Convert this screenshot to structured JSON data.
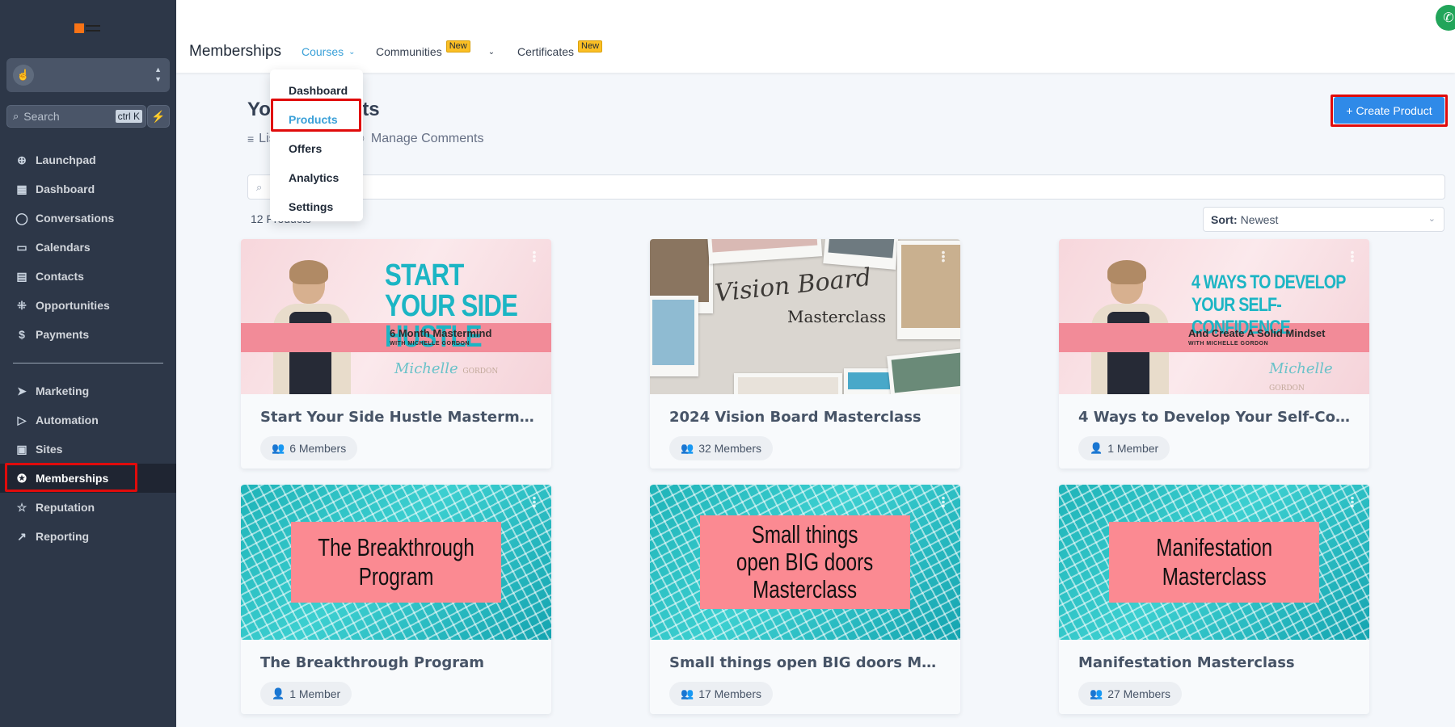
{
  "app": {
    "title": "Memberships",
    "logo": "agency-logo",
    "location_switcher_icon": "pointer-click-icon"
  },
  "sidebar": {
    "search_placeholder": "Search",
    "search_shortcut": "ctrl K",
    "quick_action_icon": "bolt-icon",
    "items": [
      {
        "label": "Launchpad",
        "icon": "launchpad-icon",
        "active": false
      },
      {
        "label": "Dashboard",
        "icon": "dashboard-grid-icon",
        "active": false
      },
      {
        "label": "Conversations",
        "icon": "chat-bubble-icon",
        "active": false
      },
      {
        "label": "Calendars",
        "icon": "calendar-icon",
        "active": false
      },
      {
        "label": "Contacts",
        "icon": "contacts-book-icon",
        "active": false
      },
      {
        "label": "Opportunities",
        "icon": "opportunities-icon",
        "active": false
      },
      {
        "label": "Payments",
        "icon": "payments-icon",
        "active": false
      },
      {
        "label": "Marketing",
        "icon": "send-icon",
        "active": false
      },
      {
        "label": "Automation",
        "icon": "automation-icon",
        "active": false
      },
      {
        "label": "Sites",
        "icon": "sites-icon",
        "active": false
      },
      {
        "label": "Memberships",
        "icon": "award-icon",
        "active": true
      },
      {
        "label": "Reputation",
        "icon": "star-icon",
        "active": false
      },
      {
        "label": "Reporting",
        "icon": "trend-icon",
        "active": false
      }
    ]
  },
  "topnav": {
    "items": [
      {
        "label": "Courses",
        "active": true,
        "has_dropdown": true,
        "badge": ""
      },
      {
        "label": "Communities",
        "active": false,
        "has_dropdown": true,
        "badge": "New"
      },
      {
        "label": "Certificates",
        "active": false,
        "has_dropdown": false,
        "badge": "New"
      }
    ],
    "courses_menu": [
      "Dashboard",
      "Products",
      "Offers",
      "Analytics",
      "Settings"
    ],
    "courses_menu_active": "Products"
  },
  "main": {
    "title": "Your Products",
    "subtabs": [
      {
        "label": "List",
        "icon": "list-icon"
      },
      {
        "label": "Manage Comments",
        "icon": "comments-icon"
      }
    ],
    "create_button": "+ Create Product",
    "search_placeholder": "",
    "count_label": "12 Products",
    "sort_label": "Sort:",
    "sort_value": "Newest"
  },
  "products": [
    {
      "title": "Start Your Side Hustle Mastermind",
      "members": "6 Members",
      "member_icon": "users-icon",
      "thumb": {
        "style": "pink",
        "headline": "START YOUR SIDE HUSTLE",
        "line1": "6 Month Mastermind",
        "line2": "WITH MICHELLE GORDON",
        "signature": "Michelle",
        "signature2": "GORDON"
      }
    },
    {
      "title": "2024 Vision Board Masterclass",
      "members": "32 Members",
      "member_icon": "users-icon",
      "thumb": {
        "style": "vision",
        "headline": "Vision Board",
        "line1": "Masterclass"
      }
    },
    {
      "title": "4 Ways to Develop Your Self-Conf...",
      "members": "1 Member",
      "member_icon": "user-icon",
      "thumb": {
        "style": "pink",
        "headline": "4 WAYS TO DEVELOP YOUR SELF-CONFIDENCE",
        "line1": "And Create A Solid Mindset",
        "line2": "WITH MICHELLE GORDON",
        "signature": "Michelle",
        "signature2": "GORDON"
      }
    },
    {
      "title": "The Breakthrough Program",
      "members": "1 Member",
      "member_icon": "user-icon",
      "thumb": {
        "style": "pool",
        "headline": "The Breakthrough\nProgram"
      }
    },
    {
      "title": "Small things open BIG doors Mas...",
      "members": "17 Members",
      "member_icon": "users-icon",
      "thumb": {
        "style": "pool",
        "headline": "Small things\nopen BIG doors\nMasterclass"
      }
    },
    {
      "title": "Manifestation Masterclass",
      "members": "27 Members",
      "member_icon": "users-icon",
      "thumb": {
        "style": "pool",
        "headline": "Manifestation\nMasterclass"
      }
    }
  ],
  "colors": {
    "sidebar_bg": "#2d3748",
    "accent": "#3aa0d8",
    "primary_button": "#2f8ae8",
    "badge_new": "#fbbf24",
    "highlight": "#e00b0b"
  }
}
